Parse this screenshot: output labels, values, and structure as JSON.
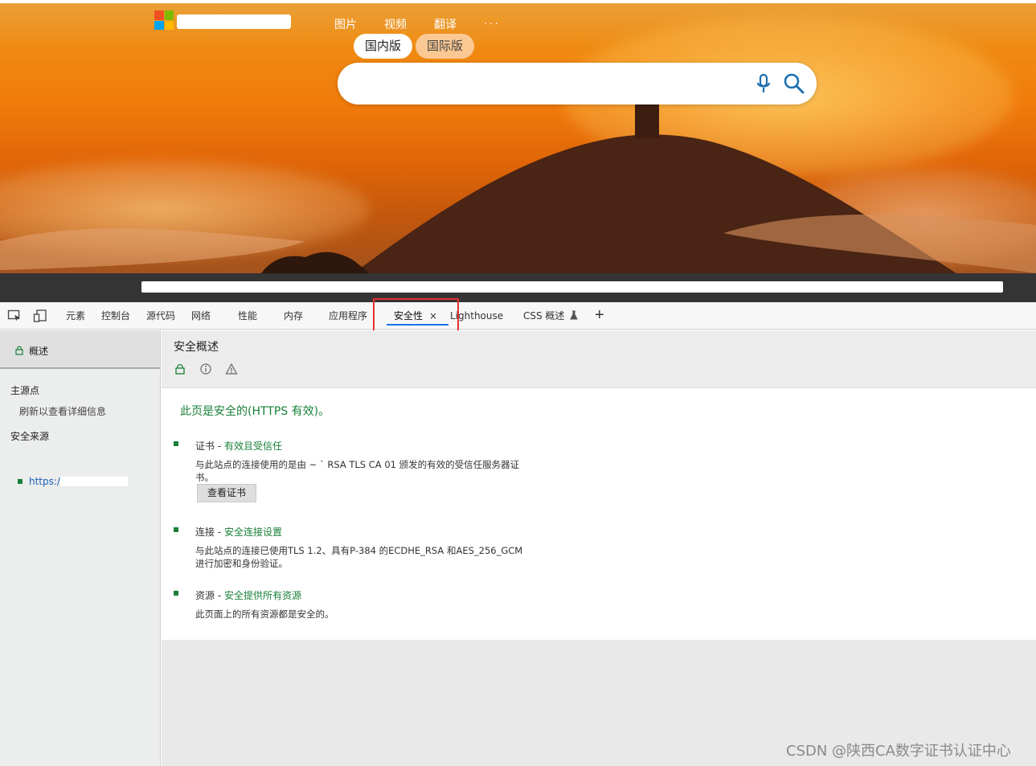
{
  "browser": {
    "nav": [
      "图片",
      "视频",
      "翻译",
      "···"
    ],
    "version_tabs": [
      "国内版",
      "国际版"
    ],
    "search_placeholder": ""
  },
  "devtools": {
    "tabs": [
      "元素",
      "控制台",
      "源代码",
      "网络",
      "性能",
      "内存",
      "应用程序",
      "安全性",
      "Lighthouse",
      "CSS 概述"
    ],
    "active_tab_close": "×",
    "add_tab": "+",
    "sidebar": {
      "overview": "概述",
      "main_origin_heading": "主源点",
      "main_origin_hint": "刷新以查看详细信息",
      "secure_origins_heading": "安全来源",
      "secure_origin": "https://"
    },
    "main": {
      "title": "安全概述",
      "summary": "此页是安全的(HTTPS 有效)。",
      "certificate": {
        "label": "证书 - ",
        "status": "有效且受信任",
        "desc": "与此站点的连接使用的是由 ~ ` RSA TLS CA 01 颁发的有效的受信任服务器证书。",
        "button": "查看证书"
      },
      "connection": {
        "label": "连接 - ",
        "status": "安全连接设置",
        "desc": "与此站点的连接已使用TLS 1.2、具有P-384 的ECDHE_RSA 和AES_256_GCM 进行加密和身份验证。"
      },
      "resources": {
        "label": "资源 - ",
        "status": "安全提供所有资源",
        "desc": "此页面上的所有资源都是安全的。"
      }
    }
  },
  "watermark": "CSDN @陕西CA数字证书认证中心",
  "colors": {
    "secure_green": "#188038",
    "highlight_red": "#e53232",
    "active_tab_underline": "#1a73e8"
  }
}
